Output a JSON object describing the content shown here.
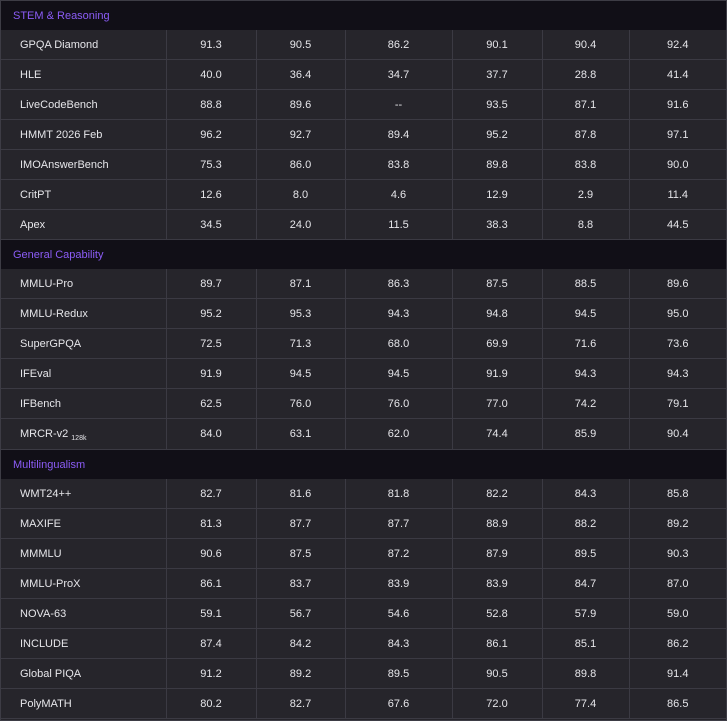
{
  "sections": [
    {
      "title": "STEM & Reasoning",
      "rows": [
        {
          "name": "GPQA Diamond",
          "values": [
            "91.3",
            "90.5",
            "86.2",
            "90.1",
            "90.4",
            "92.4"
          ]
        },
        {
          "name": "HLE",
          "values": [
            "40.0",
            "36.4",
            "34.7",
            "37.7",
            "28.8",
            "41.4"
          ]
        },
        {
          "name": "LiveCodeBench",
          "values": [
            "88.8",
            "89.6",
            "--",
            "93.5",
            "87.1",
            "91.6"
          ]
        },
        {
          "name": "HMMT 2026 Feb",
          "values": [
            "96.2",
            "92.7",
            "89.4",
            "95.2",
            "87.8",
            "97.1"
          ]
        },
        {
          "name": "IMOAnswerBench",
          "values": [
            "75.3",
            "86.0",
            "83.8",
            "89.8",
            "83.8",
            "90.0"
          ]
        },
        {
          "name": "CritPT",
          "values": [
            "12.6",
            "8.0",
            "4.6",
            "12.9",
            "2.9",
            "11.4"
          ]
        },
        {
          "name": "Apex",
          "values": [
            "34.5",
            "24.0",
            "11.5",
            "38.3",
            "8.8",
            "44.5"
          ]
        }
      ]
    },
    {
      "title": "General Capability",
      "rows": [
        {
          "name": "MMLU-Pro",
          "values": [
            "89.7",
            "87.1",
            "86.3",
            "87.5",
            "88.5",
            "89.6"
          ]
        },
        {
          "name": "MMLU-Redux",
          "values": [
            "95.2",
            "95.3",
            "94.3",
            "94.8",
            "94.5",
            "95.0"
          ]
        },
        {
          "name": "SuperGPQA",
          "values": [
            "72.5",
            "71.3",
            "68.0",
            "69.9",
            "71.6",
            "73.6"
          ]
        },
        {
          "name": "IFEval",
          "values": [
            "91.9",
            "94.5",
            "94.5",
            "91.9",
            "94.3",
            "94.3"
          ]
        },
        {
          "name": "IFBench",
          "values": [
            "62.5",
            "76.0",
            "76.0",
            "77.0",
            "74.2",
            "79.1"
          ]
        },
        {
          "name": "MRCR-v2",
          "sub": "128k",
          "values": [
            "84.0",
            "63.1",
            "62.0",
            "74.4",
            "85.9",
            "90.4"
          ]
        }
      ]
    },
    {
      "title": "Multilingualism",
      "rows": [
        {
          "name": "WMT24++",
          "values": [
            "82.7",
            "81.6",
            "81.8",
            "82.2",
            "84.3",
            "85.8"
          ]
        },
        {
          "name": "MAXIFE",
          "values": [
            "81.3",
            "87.7",
            "87.7",
            "88.9",
            "88.2",
            "89.2"
          ]
        },
        {
          "name": "MMMLU",
          "values": [
            "90.6",
            "87.5",
            "87.2",
            "87.9",
            "89.5",
            "90.3"
          ]
        },
        {
          "name": "MMLU-ProX",
          "values": [
            "86.1",
            "83.7",
            "83.9",
            "83.9",
            "84.7",
            "87.0"
          ]
        },
        {
          "name": "NOVA-63",
          "values": [
            "59.1",
            "56.7",
            "54.6",
            "52.8",
            "57.9",
            "59.0"
          ]
        },
        {
          "name": "INCLUDE",
          "values": [
            "87.4",
            "84.2",
            "84.3",
            "86.1",
            "85.1",
            "86.2"
          ]
        },
        {
          "name": "Global PIQA",
          "values": [
            "91.2",
            "89.2",
            "89.5",
            "90.5",
            "89.8",
            "91.4"
          ]
        },
        {
          "name": "PolyMATH",
          "values": [
            "80.2",
            "82.7",
            "67.6",
            "72.0",
            "77.4",
            "86.5"
          ]
        }
      ]
    }
  ],
  "colors": {
    "section_title": "#8b5cf6",
    "section_bg": "#110f17",
    "row_bg": "#26252b",
    "grid": "#3b3a43",
    "text": "#e6e6ea"
  }
}
